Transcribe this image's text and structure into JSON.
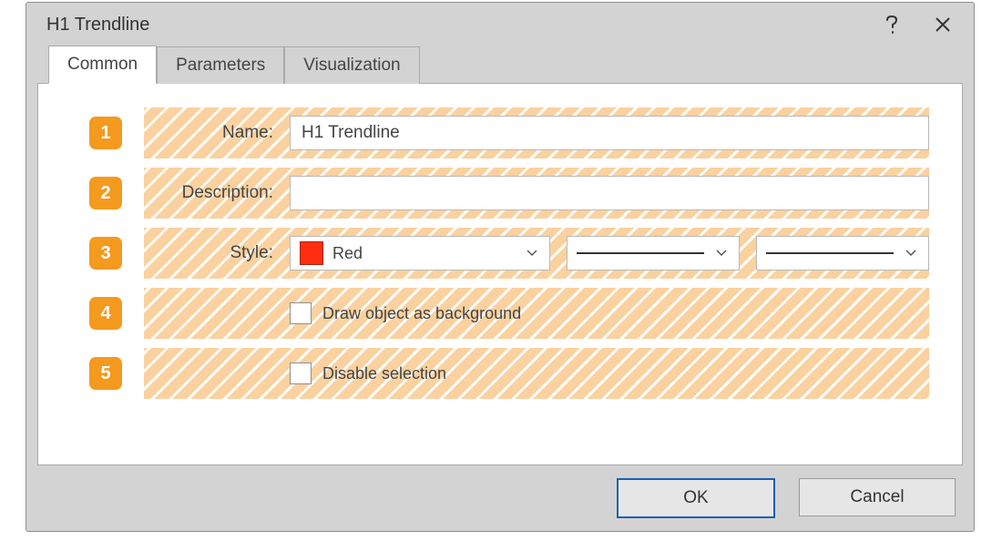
{
  "window": {
    "title": "H1 Trendline"
  },
  "tabs": {
    "common": "Common",
    "parameters": "Parameters",
    "visualization": "Visualization",
    "active": "common"
  },
  "badges": {
    "r1": "1",
    "r2": "2",
    "r3": "3",
    "r4": "4",
    "r5": "5"
  },
  "labels": {
    "name": "Name:",
    "description": "Description:",
    "style": "Style:"
  },
  "fields": {
    "name_value": "H1 Trendline",
    "description_value": ""
  },
  "style": {
    "color_label": "Red",
    "color_hex": "#ff2e12",
    "line_style": "solid",
    "line_width": "1"
  },
  "checks": {
    "draw_bg_label": "Draw object as background",
    "draw_bg_checked": false,
    "disable_sel_label": "Disable selection",
    "disable_sel_checked": false
  },
  "buttons": {
    "ok": "OK",
    "cancel": "Cancel"
  }
}
